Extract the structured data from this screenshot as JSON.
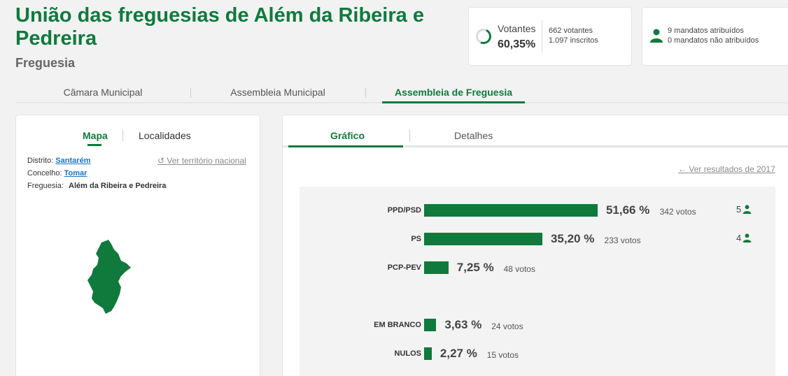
{
  "header": {
    "title": "União das freguesias de Além da Ribeira e Pedreira",
    "subtitle": "Freguesia"
  },
  "summary": {
    "votantes_label": "Votantes",
    "votantes_pct": "60,35%",
    "votantes_pct_value": 60.35,
    "votantes_count": "662 votantes",
    "inscritos_count": "1.097 inscritos",
    "mandatos_atribuidos": "9 mandatos atribuídos",
    "mandatos_nao_atribuidos": "0 mandatos não atribuídos"
  },
  "main_tabs": [
    {
      "label": "Câmara Municipal",
      "active": false
    },
    {
      "label": "Assembleia Municipal",
      "active": false
    },
    {
      "label": "Assembleia de Freguesia",
      "active": true
    }
  ],
  "left_panel": {
    "tabs": [
      {
        "label": "Mapa",
        "active": true
      },
      {
        "label": "Localidades",
        "active": false
      }
    ],
    "distrito_label": "Distrito:",
    "distrito_value": "Santarém",
    "concelho_label": "Concelho:",
    "concelho_value": "Tomar",
    "freguesia_label": "Freguesia:",
    "freguesia_value": "Além da Ribeira e Pedreira",
    "national_link": "Ver território nacional"
  },
  "right_panel": {
    "tabs": [
      {
        "label": "Gráfico",
        "active": true
      },
      {
        "label": "Detalhes",
        "active": false
      }
    ],
    "previous_results_link": "Ver resultados de 2017"
  },
  "colors": {
    "accent": "#0f7a3c",
    "link": "#1a73c8"
  },
  "chart_data": {
    "type": "bar",
    "orientation": "horizontal",
    "categories": [
      "PPD/PSD",
      "PS",
      "PCP-PEV",
      "EM BRANCO",
      "NULOS"
    ],
    "values": [
      51.66,
      35.2,
      7.25,
      3.63,
      2.27
    ],
    "value_labels": [
      "51,66 %",
      "35,20 %",
      "7,25 %",
      "3,63 %",
      "2,27 %"
    ],
    "votes": [
      "342 votos",
      "233 votos",
      "48 votos",
      "24 votos",
      "15 votos"
    ],
    "mandates": [
      "5",
      "4",
      "",
      "",
      ""
    ]
  }
}
